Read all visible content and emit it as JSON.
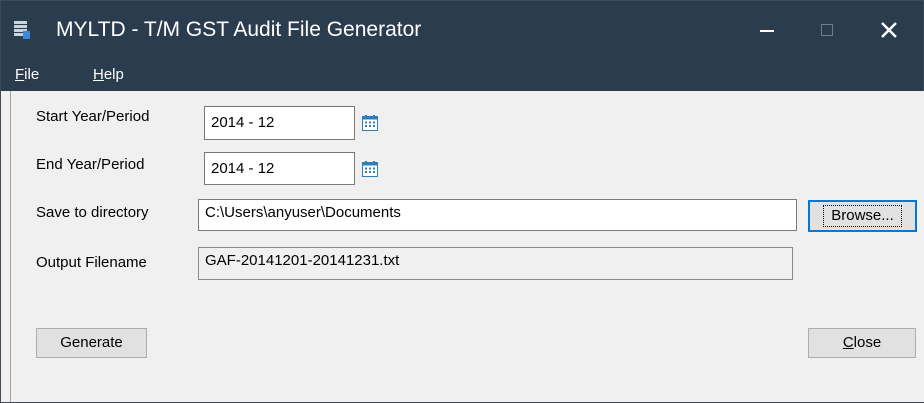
{
  "window": {
    "title": "MYLTD - T/M GST Audit File Generator",
    "controls": {
      "minimize": "—",
      "maximize": "☐",
      "close": "✕"
    }
  },
  "menu": {
    "file": {
      "mnemonic": "F",
      "rest": "ile"
    },
    "help": {
      "mnemonic": "H",
      "rest": "elp"
    }
  },
  "form": {
    "start_label": "Start Year/Period",
    "start_value": "2014 - 12",
    "end_label": "End Year/Period",
    "end_value": "2014 - 12",
    "dir_label": "Save to directory",
    "dir_value": "C:\\Users\\anyuser\\Documents",
    "browse_label": "Browse...",
    "output_label": "Output Filename",
    "output_value": "GAF-20141201-20141231.txt"
  },
  "actions": {
    "generate_label": "Generate",
    "close_mnemonic": "C",
    "close_rest": "lose"
  },
  "icons": {
    "app": "document-icon",
    "calendar": "calendar-icon"
  },
  "colors": {
    "titlebar": "#2b3c4f",
    "focus_accent": "#0078d7",
    "calendar_accent": "#2e7fb8"
  }
}
